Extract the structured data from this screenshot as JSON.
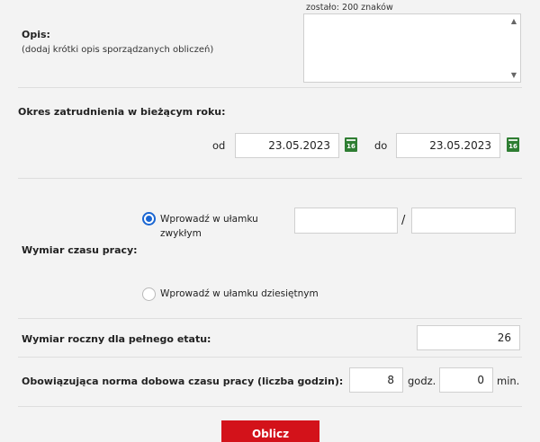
{
  "description": {
    "counter_text": "zostało: 200 znaków",
    "label": "Opis:",
    "hint": "(dodaj krótki opis sporządzanych obliczeń)",
    "value": ""
  },
  "employment_period": {
    "label": "Okres zatrudnienia w bieżącym roku:",
    "from_label": "od",
    "from_value": "23.05.2023",
    "to_label": "do",
    "to_value": "23.05.2023",
    "calendar_icon_text": "16"
  },
  "work_time": {
    "label": "Wymiar czasu pracy:",
    "option_fraction": "Wprowadź w ułamku zwykłym",
    "option_decimal": "Wprowadź w ułamku dziesiętnym",
    "selected": "fraction",
    "numerator": "",
    "slash": "/",
    "denominator": ""
  },
  "annual": {
    "label": "Wymiar roczny dla pełnego etatu:",
    "value": "26"
  },
  "daily_norm": {
    "label": "Obowiązująca norma dobowa czasu pracy (liczba godzin):",
    "hours_value": "8",
    "hours_unit": "godz.",
    "minutes_value": "0",
    "minutes_unit": "min."
  },
  "submit": {
    "label": "Oblicz"
  },
  "colors": {
    "accent_red": "#d3121a",
    "radio_blue": "#1a66d2",
    "calendar_green": "#2e7d32"
  }
}
